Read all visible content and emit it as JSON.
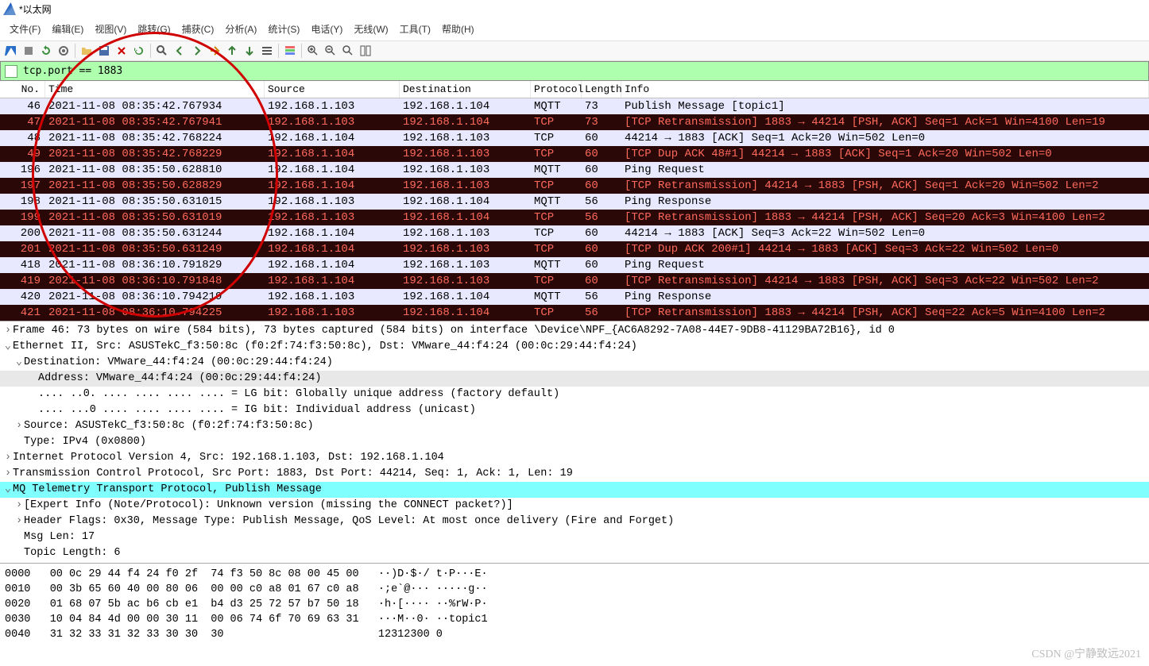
{
  "window": {
    "title": "*以太网"
  },
  "menu": [
    "文件(F)",
    "编辑(E)",
    "视图(V)",
    "跳转(G)",
    "捕获(C)",
    "分析(A)",
    "统计(S)",
    "电话(Y)",
    "无线(W)",
    "工具(T)",
    "帮助(H)"
  ],
  "filter": {
    "value": "tcp.port == 1883"
  },
  "columns": {
    "no": "No.",
    "time": "Time",
    "src": "Source",
    "dst": "Destination",
    "proto": "Protocol",
    "len": "Length",
    "info": "Info"
  },
  "packets": [
    {
      "no": "46",
      "time": "2021-11-08 08:35:42.767934",
      "src": "192.168.1.103",
      "dst": "192.168.1.104",
      "proto": "MQTT",
      "len": "73",
      "info": "Publish Message [topic1]",
      "style": "light"
    },
    {
      "no": "47",
      "time": "2021-11-08 08:35:42.767941",
      "src": "192.168.1.103",
      "dst": "192.168.1.104",
      "proto": "TCP",
      "len": "73",
      "info": "[TCP Retransmission] 1883 → 44214 [PSH, ACK] Seq=1 Ack=1 Win=4100 Len=19",
      "style": "dark"
    },
    {
      "no": "48",
      "time": "2021-11-08 08:35:42.768224",
      "src": "192.168.1.104",
      "dst": "192.168.1.103",
      "proto": "TCP",
      "len": "60",
      "info": "44214 → 1883 [ACK] Seq=1 Ack=20 Win=502 Len=0",
      "style": "light"
    },
    {
      "no": "49",
      "time": "2021-11-08 08:35:42.768229",
      "src": "192.168.1.104",
      "dst": "192.168.1.103",
      "proto": "TCP",
      "len": "60",
      "info": "[TCP Dup ACK 48#1] 44214 → 1883 [ACK] Seq=1 Ack=20 Win=502 Len=0",
      "style": "dark"
    },
    {
      "no": "196",
      "time": "2021-11-08 08:35:50.628810",
      "src": "192.168.1.104",
      "dst": "192.168.1.103",
      "proto": "MQTT",
      "len": "60",
      "info": "Ping Request",
      "style": "light"
    },
    {
      "no": "197",
      "time": "2021-11-08 08:35:50.628829",
      "src": "192.168.1.104",
      "dst": "192.168.1.103",
      "proto": "TCP",
      "len": "60",
      "info": "[TCP Retransmission] 44214 → 1883 [PSH, ACK] Seq=1 Ack=20 Win=502 Len=2",
      "style": "dark"
    },
    {
      "no": "198",
      "time": "2021-11-08 08:35:50.631015",
      "src": "192.168.1.103",
      "dst": "192.168.1.104",
      "proto": "MQTT",
      "len": "56",
      "info": "Ping Response",
      "style": "light"
    },
    {
      "no": "199",
      "time": "2021-11-08 08:35:50.631019",
      "src": "192.168.1.103",
      "dst": "192.168.1.104",
      "proto": "TCP",
      "len": "56",
      "info": "[TCP Retransmission] 1883 → 44214 [PSH, ACK] Seq=20 Ack=3 Win=4100 Len=2",
      "style": "dark"
    },
    {
      "no": "200",
      "time": "2021-11-08 08:35:50.631244",
      "src": "192.168.1.104",
      "dst": "192.168.1.103",
      "proto": "TCP",
      "len": "60",
      "info": "44214 → 1883 [ACK] Seq=3 Ack=22 Win=502 Len=0",
      "style": "light"
    },
    {
      "no": "201",
      "time": "2021-11-08 08:35:50.631249",
      "src": "192.168.1.104",
      "dst": "192.168.1.103",
      "proto": "TCP",
      "len": "60",
      "info": "[TCP Dup ACK 200#1] 44214 → 1883 [ACK] Seq=3 Ack=22 Win=502 Len=0",
      "style": "dark"
    },
    {
      "no": "418",
      "time": "2021-11-08 08:36:10.791829",
      "src": "192.168.1.104",
      "dst": "192.168.1.103",
      "proto": "MQTT",
      "len": "60",
      "info": "Ping Request",
      "style": "light"
    },
    {
      "no": "419",
      "time": "2021-11-08 08:36:10.791848",
      "src": "192.168.1.104",
      "dst": "192.168.1.103",
      "proto": "TCP",
      "len": "60",
      "info": "[TCP Retransmission] 44214 → 1883 [PSH, ACK] Seq=3 Ack=22 Win=502 Len=2",
      "style": "dark"
    },
    {
      "no": "420",
      "time": "2021-11-08 08:36:10.794219",
      "src": "192.168.1.103",
      "dst": "192.168.1.104",
      "proto": "MQTT",
      "len": "56",
      "info": "Ping Response",
      "style": "light"
    },
    {
      "no": "421",
      "time": "2021-11-08 08:36:10.794225",
      "src": "192.168.1.103",
      "dst": "192.168.1.104",
      "proto": "TCP",
      "len": "56",
      "info": "[TCP Retransmission] 1883 → 44214 [PSH, ACK] Seq=22 Ack=5 Win=4100 Len=2",
      "style": "dark"
    }
  ],
  "details": {
    "frame": "Frame 46: 73 bytes on wire (584 bits), 73 bytes captured (584 bits) on interface \\Device\\NPF_{AC6A8292-7A08-44E7-9DB8-41129BA72B16}, id 0",
    "eth": "Ethernet II, Src: ASUSTekC_f3:50:8c (f0:2f:74:f3:50:8c), Dst: VMware_44:f4:24 (00:0c:29:44:f4:24)",
    "eth_dst": "Destination: VMware_44:f4:24 (00:0c:29:44:f4:24)",
    "eth_addr": "Address: VMware_44:f4:24 (00:0c:29:44:f4:24)",
    "eth_lg": ".... ..0. .... .... .... .... = LG bit: Globally unique address (factory default)",
    "eth_ig": ".... ...0 .... .... .... .... = IG bit: Individual address (unicast)",
    "eth_src": "Source: ASUSTekC_f3:50:8c (f0:2f:74:f3:50:8c)",
    "eth_type": "Type: IPv4 (0x0800)",
    "ip": "Internet Protocol Version 4, Src: 192.168.1.103, Dst: 192.168.1.104",
    "tcp": "Transmission Control Protocol, Src Port: 1883, Dst Port: 44214, Seq: 1, Ack: 1, Len: 19",
    "mqtt": "MQ Telemetry Transport Protocol, Publish Message",
    "mqtt_expert": "[Expert Info (Note/Protocol): Unknown version (missing the CONNECT packet?)]",
    "mqtt_flags": "Header Flags: 0x30, Message Type: Publish Message, QoS Level: At most once delivery (Fire and Forget)",
    "mqtt_len": "Msg Len: 17",
    "mqtt_topic": "Topic Length: 6"
  },
  "hex": {
    "l0": "0000   00 0c 29 44 f4 24 f0 2f  74 f3 50 8c 08 00 45 00   ··)D·$·/ t·P···E·",
    "l1": "0010   00 3b 65 60 40 00 80 06  00 00 c0 a8 01 67 c0 a8   ·;e`@··· ·····g··",
    "l2": "0020   01 68 07 5b ac b6 cb e1  b4 d3 25 72 57 b7 50 18   ·h·[···· ··%rW·P·",
    "l3": "0030   10 04 84 4d 00 00 30 11  00 06 74 6f 70 69 63 31   ···M··0· ··topic1",
    "l4": "0040   31 32 33 31 32 33 30 30  30                        12312300 0"
  },
  "watermark": "CSDN @宁静致远2021"
}
